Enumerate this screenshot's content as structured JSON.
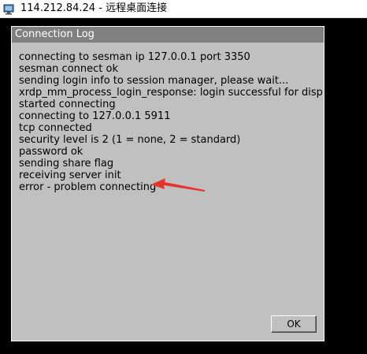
{
  "window": {
    "title": "114.212.84.24 - 远程桌面连接",
    "icon": "remote-desktop-icon"
  },
  "dialog": {
    "title": "Connection Log",
    "log_lines": [
      "connecting to sesman ip 127.0.0.1 port 3350",
      "sesman connect ok",
      "sending login info to session manager, please wait...",
      "xrdp_mm_process_login_response: login successful for display",
      "started connecting",
      "connecting to 127.0.0.1 5911",
      "tcp connected",
      "security level is 2 (1 = none, 2 = standard)",
      "password ok",
      "sending share flag",
      "receiving server init",
      "error - problem connecting"
    ],
    "ok_label": "OK"
  },
  "annotation": {
    "arrow_color": "#e8332d"
  }
}
